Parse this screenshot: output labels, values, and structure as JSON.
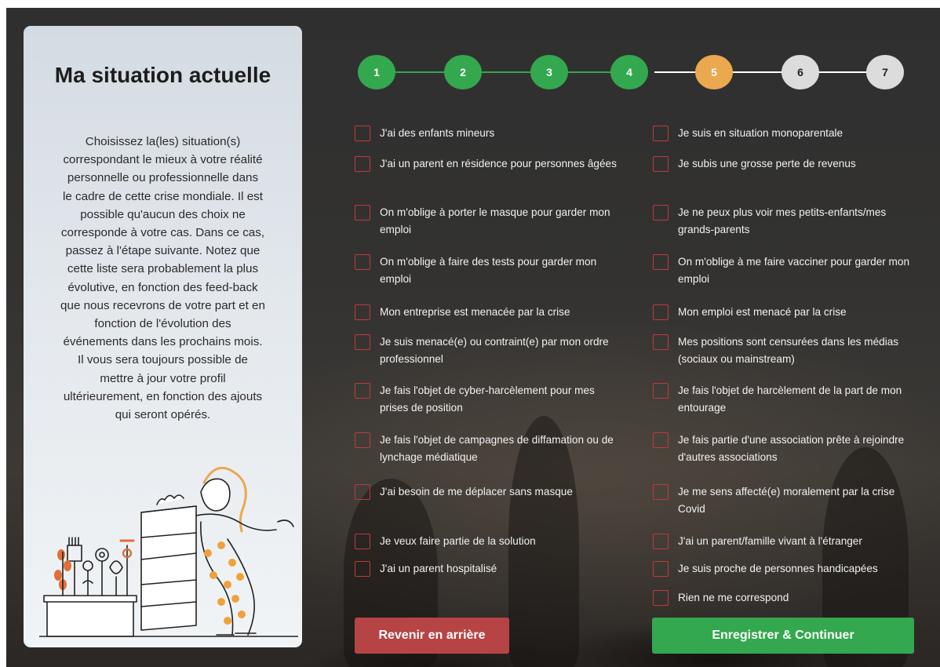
{
  "panel": {
    "title": "Ma situation actuelle",
    "description_lines": [
      "Choisissez la(les) situation(s)",
      "correspondant le mieux à votre réalité",
      "personnelle ou professionnelle dans",
      "le cadre de cette crise mondiale. Il est",
      "possible qu'aucun des choix ne",
      "corresponde à votre cas. Dans ce cas,",
      "passez à l'étape suivante. Notez que",
      "cette liste sera probablement la plus",
      "évolutive, en fonction des feed-back",
      "que nous recevrons de votre part et en",
      "fonction de l'évolution des",
      "événements dans les prochains mois.",
      "Il vous sera toujours possible de",
      "mettre à jour votre profil",
      "ultérieurement, en fonction des ajouts",
      "qui seront opérés."
    ]
  },
  "stepper": {
    "steps": [
      {
        "label": "1",
        "state": "done"
      },
      {
        "label": "2",
        "state": "done"
      },
      {
        "label": "3",
        "state": "done"
      },
      {
        "label": "4",
        "state": "done"
      },
      {
        "label": "5",
        "state": "current"
      },
      {
        "label": "6",
        "state": "todo"
      },
      {
        "label": "7",
        "state": "todo"
      }
    ],
    "colors": {
      "done": "#33a84e",
      "current": "#eaa84f",
      "todo": "#dcdcdc"
    }
  },
  "options_left": [
    {
      "label": "J'ai des enfants mineurs",
      "checked": false
    },
    {
      "label": "J'ai un parent en résidence pour personnes âgées",
      "checked": false
    },
    {
      "label": "On m'oblige à porter le masque pour garder mon emploi",
      "checked": false
    },
    {
      "label": "On m'oblige à faire des tests pour garder mon emploi",
      "checked": false
    },
    {
      "label": "Mon entreprise est menacée par la crise",
      "checked": false
    },
    {
      "label": "Je suis menacé(e) ou contraint(e) par mon ordre professionnel",
      "checked": false
    },
    {
      "label": "Je fais l'objet de cyber-harcèlement pour mes prises de position",
      "checked": false
    },
    {
      "label": "Je fais l'objet de campagnes de diffamation ou de lynchage médiatique",
      "checked": false
    },
    {
      "label": "J'ai besoin de me déplacer sans masque",
      "checked": false
    },
    {
      "label": "Je veux faire partie de la solution",
      "checked": false
    },
    {
      "label": "J'ai un parent hospitalisé",
      "checked": false
    }
  ],
  "options_right": [
    {
      "label": "Je suis en situation monoparentale",
      "checked": false
    },
    {
      "label": "Je subis une grosse perte de revenus",
      "checked": false
    },
    {
      "label": "Je ne peux plus voir mes petits-enfants/mes grands-parents",
      "checked": false
    },
    {
      "label": "On m'oblige à me faire vacciner pour garder mon emploi",
      "checked": false
    },
    {
      "label": "Mon emploi est menacé par la crise",
      "checked": false
    },
    {
      "label": "Mes positions sont censurées dans les médias (sociaux ou mainstream)",
      "checked": false
    },
    {
      "label": "Je fais l'objet de harcèlement de la part de mon entourage",
      "checked": false
    },
    {
      "label": "Je fais partie d'une association prête à rejoindre d'autres associations",
      "checked": false
    },
    {
      "label": "Je me sens affecté(e) moralement par la crise Covid",
      "checked": false
    },
    {
      "label": "J'ai un parent/famille vivant à l'étranger",
      "checked": false
    },
    {
      "label": "Je suis proche de personnes handicapées",
      "checked": false
    },
    {
      "label": "Rien ne me correspond",
      "checked": false
    }
  ],
  "buttons": {
    "back_label": "Revenir en arrière",
    "next_label": "Enregistrer & Continuer",
    "back_color": "#b64444",
    "next_color": "#33a84e"
  },
  "colors": {
    "checkbox_border": "#c03b3b",
    "option_text": "#f2f2f2"
  }
}
